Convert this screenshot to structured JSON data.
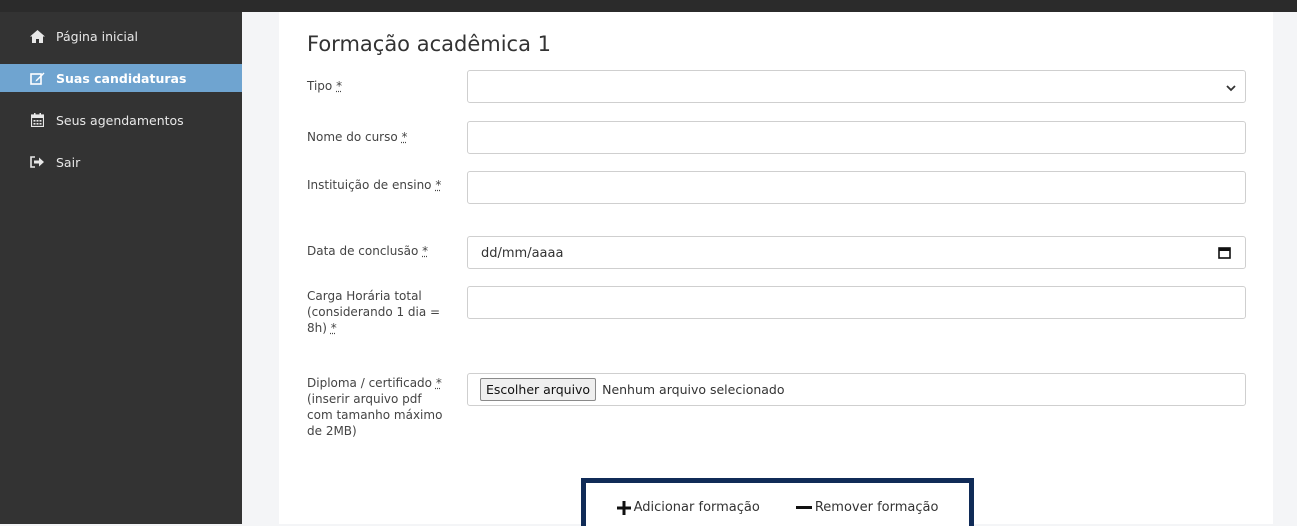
{
  "sidebar": {
    "items": [
      {
        "label": "Página inicial",
        "icon": "home-icon"
      },
      {
        "label": "Suas candidaturas",
        "icon": "edit-icon"
      },
      {
        "label": "Seus agendamentos",
        "icon": "calendar-icon"
      },
      {
        "label": "Sair",
        "icon": "sign-out-icon"
      }
    ]
  },
  "form": {
    "section_title": "Formação acadêmica 1",
    "required_mark": "*",
    "tipo": {
      "label": "Tipo",
      "value": ""
    },
    "nome_curso": {
      "label": "Nome do curso",
      "value": ""
    },
    "instituicao": {
      "label": "Instituição de ensino",
      "value": ""
    },
    "data_conclusao": {
      "label": "Data de conclusão",
      "placeholder": "dd/mm/aaaa"
    },
    "carga_horaria": {
      "label": "Carga Horária total (considerando 1 dia = 8h)",
      "value": ""
    },
    "diploma": {
      "label": "Diploma / certificado",
      "label_suffix": " (inserir arquivo pdf com tamanho máximo de 2MB)",
      "button_label": "Escolher arquivo",
      "status": "Nenhum arquivo selecionado"
    }
  },
  "actions": {
    "add_label": "Adicionar formação",
    "remove_label": "Remover formação"
  },
  "colors": {
    "sidebar_bg": "#333333",
    "sidebar_active": "#6fa4d0",
    "action_border": "#102b57"
  }
}
